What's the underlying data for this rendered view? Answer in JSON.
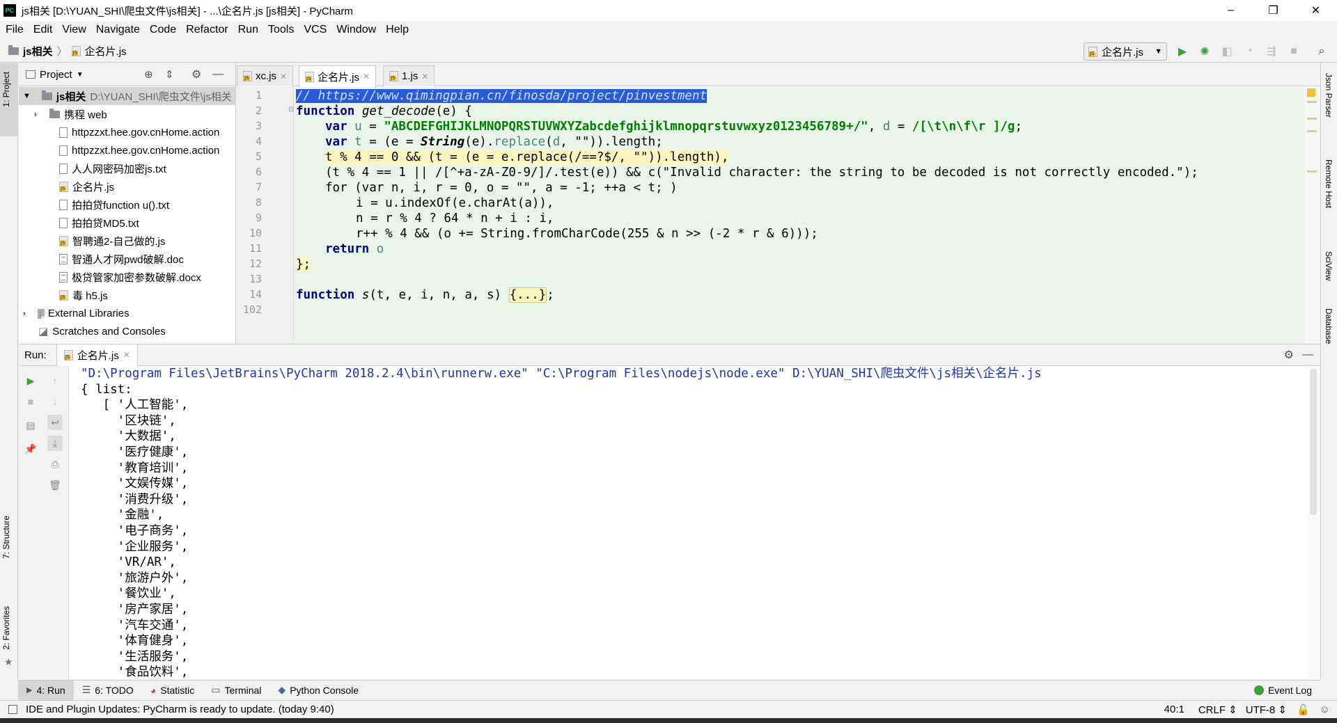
{
  "window": {
    "title": "js相关 [D:\\YUAN_SHI\\爬虫文件\\js相关] - ...\\企名片.js [js相关] - PyCharm",
    "app_icon": "PC",
    "minimize": "–",
    "maximize": "❐",
    "close": "✕"
  },
  "menu": [
    "File",
    "Edit",
    "View",
    "Navigate",
    "Code",
    "Refactor",
    "Run",
    "Tools",
    "VCS",
    "Window",
    "Help"
  ],
  "breadcrumb": {
    "project": "js相关",
    "file": "企名片.js"
  },
  "run_config": {
    "label": "企名片.js"
  },
  "project_panel": {
    "title": "Project",
    "root": {
      "name": "js相关",
      "path": "D:\\YUAN_SHI\\爬虫文件\\js相关"
    },
    "items": [
      {
        "name": "携程 web",
        "type": "folder"
      },
      {
        "name": "httpzzxt.hee.gov.cnHome.action",
        "type": "txt"
      },
      {
        "name": "httpzzxt.hee.gov.cnHome.action",
        "type": "txt"
      },
      {
        "name": "人人网密码加密js.txt",
        "type": "txt"
      },
      {
        "name": "企名片.js",
        "type": "js"
      },
      {
        "name": "拍拍贷function u().txt",
        "type": "txt"
      },
      {
        "name": "拍拍贷MD5.txt",
        "type": "txt"
      },
      {
        "name": "智聘通2-自己做的.js",
        "type": "js"
      },
      {
        "name": "智通人才网pwd破解.doc",
        "type": "doc"
      },
      {
        "name": "极贷管家加密参数破解.docx",
        "type": "doc"
      },
      {
        "name": "毒 h5.js",
        "type": "js"
      }
    ],
    "external": "External Libraries",
    "scratches": "Scratches and Consoles"
  },
  "editor_tabs": [
    "xc.js",
    "企名片.js",
    "1.js"
  ],
  "line_numbers": [
    "1",
    "2",
    "3",
    "4",
    "5",
    "6",
    "7",
    "8",
    "9",
    "10",
    "11",
    "12",
    "13",
    "14",
    "102"
  ],
  "code": {
    "l1": "// https://www.qimingpian.cn/finosda/project/pinvestment",
    "l2_kw": "function",
    "l2_name": "get_decode",
    "l2_rest": "(e) {",
    "l3_var": "var",
    "l3_u": "u",
    "l3_eq": " = ",
    "l3_str": "\"ABCDEFGHIJKLMNOPQRSTUVWXYZabcdefghijklmnopqrstuvwxyz0123456789+/\"",
    "l3_mid": ", ",
    "l3_d": "d",
    "l3_eq2": " = ",
    "l3_re": "/[\\t\\n\\f\\r ]/g",
    "l3_end": ";",
    "l4_var": "var",
    "l4_t": "t",
    "l4_a": " = (",
    "l4_e": "e",
    "l4_b": " = ",
    "l4_cls": "String",
    "l4_c": "(e).",
    "l4_fn": "replace",
    "l4_d": "(",
    "l4_dv": "d",
    "l4_e2": ", \"\")).length;",
    "l5": "t % 4 == 0 && (t = (e = e.replace(/==?$/, \"\")).length),",
    "l6": "(t % 4 == 1 || /[^+a-zA-Z0-9/]/.test(e)) && c(\"Invalid character: the string to be decoded is not correctly encoded.\");",
    "l7": "for (var n, i, r = 0, o = \"\", a = -1; ++a < t; )",
    "l8": "i = u.indexOf(e.charAt(a)),",
    "l9": "n = r % 4 ? 64 * n + i : i,",
    "l10": "r++ % 4 && (o += String.fromCharCode(255 & n >> (-2 * r & 6)));",
    "l11_kw": "return",
    "l11_rest": "o",
    "l12": "};",
    "l14_kw": "function",
    "l14_name": "s",
    "l14_args": "(t, e, i, n, a, s)",
    "l14_fold": "{...}",
    "l14_end": ";"
  },
  "run_panel": {
    "label": "Run:",
    "tab": "企名片.js",
    "command": "\"D:\\Program Files\\JetBrains\\PyCharm 2018.2.4\\bin\\runnerw.exe\" \"C:\\Program Files\\nodejs\\node.exe\" D:\\YUAN_SHI\\爬虫文件\\js相关\\企名片.js",
    "output": [
      "{ list:",
      "   [ '人工智能',",
      "     '区块链',",
      "     '大数据',",
      "     '医疗健康',",
      "     '教育培训',",
      "     '文娱传媒',",
      "     '消费升级',",
      "     '金融',",
      "     '电子商务',",
      "     '企业服务',",
      "     'VR/AR',",
      "     '旅游户外',",
      "     '餐饮业',",
      "     '房产家居',",
      "     '汽车交通',",
      "     '体育健身',",
      "     '生活服务',",
      "     '食品饮料',"
    ]
  },
  "left_strip": {
    "project": "1: Project",
    "structure": "7: Structure",
    "favorites": "2: Favorites"
  },
  "right_strip": [
    "Json Parser",
    "Remote Host",
    "SciView",
    "Database"
  ],
  "bottom_tabs": [
    {
      "label": "4: Run",
      "icon": "run-icon"
    },
    {
      "label": "6: TODO",
      "icon": "todo-icon"
    },
    {
      "label": "Statistic",
      "icon": "statistic-icon"
    },
    {
      "label": "Terminal",
      "icon": "terminal-icon"
    },
    {
      "label": "Python Console",
      "icon": "python-console-icon"
    }
  ],
  "event_log": "Event Log",
  "status": {
    "message": "IDE and Plugin Updates: PyCharm is ready to update. (today 9:40)",
    "position": "40:1",
    "line_sep": "CRLF ⇕",
    "encoding": "UTF-8 ⇕"
  },
  "colors": {
    "accent_blue": "#2a5bd7",
    "run_green": "#3c9e3c",
    "code_bg": "#e8f5e8"
  }
}
